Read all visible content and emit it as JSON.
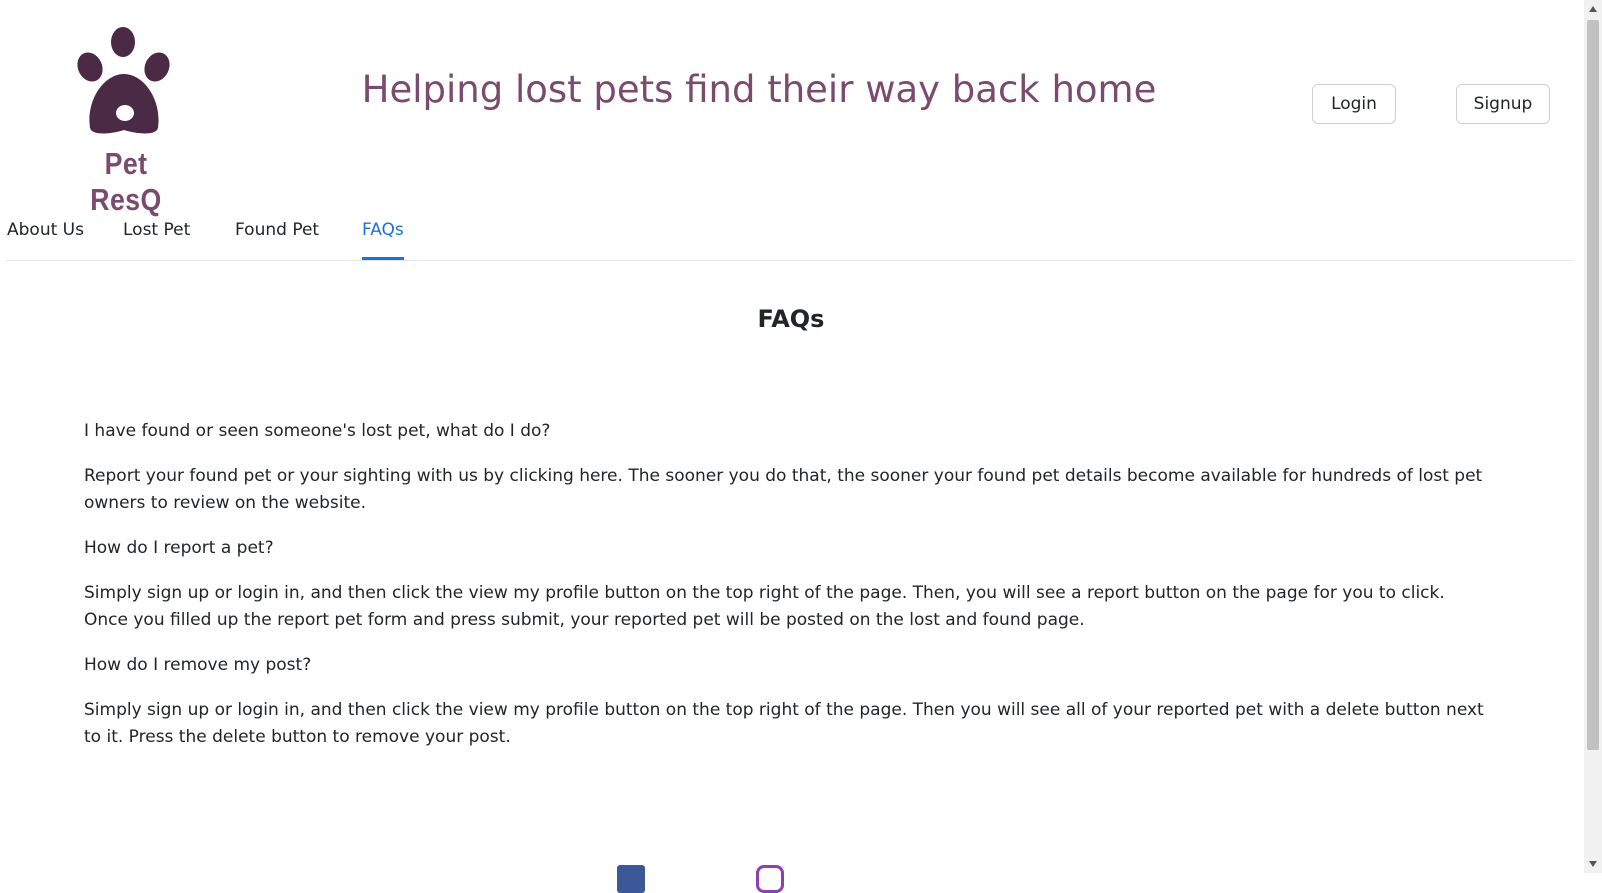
{
  "brand": {
    "name": "Pet ResQ",
    "logo_icon": "paw-icon",
    "color": "#7b4a6f"
  },
  "header": {
    "tagline": "Helping lost pets find their way back home",
    "login_label": "Login",
    "signup_label": "Signup"
  },
  "nav": {
    "items": [
      {
        "label": "About Us"
      },
      {
        "label": "Lost Pet"
      },
      {
        "label": "Found Pet"
      },
      {
        "label": "FAQs",
        "active": true
      }
    ],
    "active_color": "#1e6fe0"
  },
  "faq": {
    "heading": "FAQs",
    "entries": [
      {
        "question": "I have found or seen someone's lost pet, what do I do?",
        "answer": "Report your found pet or your sighting with us by clicking here. The sooner you do that, the sooner your found pet details become available for hundreds of lost pet owners to review on the website."
      },
      {
        "question": "How do I report a pet?",
        "answer": "Simply sign up or login in, and then click the view my profile button on the top right of the page. Then, you will see a report button on the page for you to click. Once you filled up the report pet form and press submit, your reported pet will be posted on the lost and found page."
      },
      {
        "question": "How do I remove my post?",
        "answer": "Simply sign up or login in, and then click the view my profile button on the top right of the page. Then you will see all of your reported pet with a delete button next to it. Press the delete button to remove your post."
      }
    ]
  },
  "footer": {
    "social": [
      {
        "icon": "facebook-icon",
        "color": "#3b5998"
      },
      {
        "icon": "instagram-icon",
        "color": "#8e3fb5"
      }
    ]
  }
}
